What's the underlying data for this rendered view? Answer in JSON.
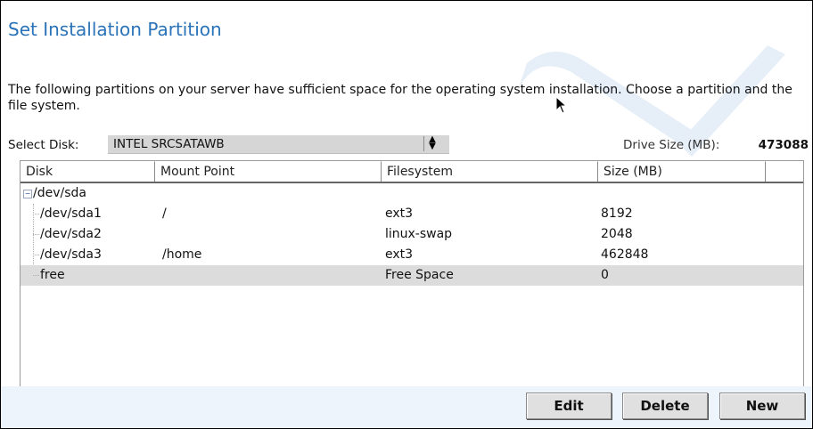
{
  "page": {
    "title": "Set Installation Partition",
    "intro": "The following partitions on your server have sufficient space for the operating system installation. Choose a partition and the file system."
  },
  "disk": {
    "label": "Select Disk:",
    "selected": "INTEL SRCSATAWB",
    "drive_size_label": "Drive Size (MB):",
    "drive_size_value": "473088"
  },
  "table": {
    "columns": [
      "Disk",
      "Mount Point",
      "Filesystem",
      "Size (MB)"
    ],
    "root": "/dev/sda",
    "rows": [
      {
        "disk": "/dev/sda1",
        "mount": "/",
        "fs": "ext3",
        "size": "8192"
      },
      {
        "disk": "/dev/sda2",
        "mount": "",
        "fs": "linux-swap",
        "size": "2048"
      },
      {
        "disk": "/dev/sda3",
        "mount": "/home",
        "fs": "ext3",
        "size": "462848"
      },
      {
        "disk": "free",
        "mount": "",
        "fs": "Free Space",
        "size": "0",
        "selected": true
      }
    ]
  },
  "buttons": {
    "edit": "Edit",
    "delete": "Delete",
    "new": "New"
  },
  "colors": {
    "title": "#2a73b8",
    "selected_row": "#dcdcdc",
    "button_bar": "#eef4fb"
  },
  "icons": [
    "expander-minus-icon",
    "select-updown-arrows-icon",
    "watermark-wrench-check-icon",
    "mouse-cursor-icon"
  ]
}
